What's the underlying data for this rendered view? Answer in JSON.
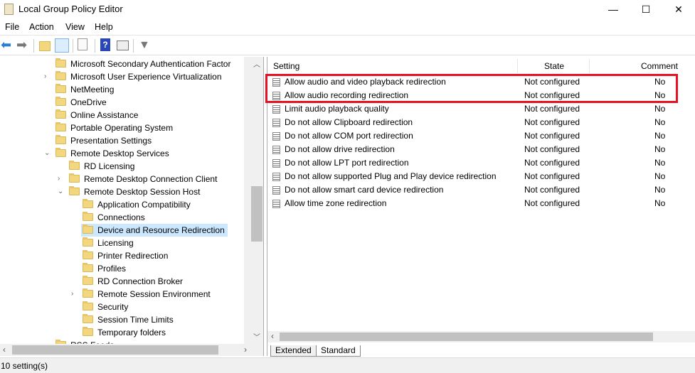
{
  "window": {
    "title": "Local Group Policy Editor",
    "minimize": "—",
    "maximize": "☐",
    "close": "✕"
  },
  "menu": [
    "File",
    "Action",
    "View",
    "Help"
  ],
  "toolbar": [
    "back-icon",
    "forward-icon",
    "up-folder-icon",
    "show-hide-tree-icon",
    "export-list-icon",
    "help-icon",
    "action-pane-icon",
    "filter-icon"
  ],
  "tree": [
    {
      "label": "Microsoft Secondary Authentication Factor",
      "level": 0,
      "expander": ""
    },
    {
      "label": "Microsoft User Experience Virtualization",
      "level": 0,
      "expander": "›"
    },
    {
      "label": "NetMeeting",
      "level": 0,
      "expander": ""
    },
    {
      "label": "OneDrive",
      "level": 0,
      "expander": ""
    },
    {
      "label": "Online Assistance",
      "level": 0,
      "expander": ""
    },
    {
      "label": "Portable Operating System",
      "level": 0,
      "expander": ""
    },
    {
      "label": "Presentation Settings",
      "level": 0,
      "expander": ""
    },
    {
      "label": "Remote Desktop Services",
      "level": 0,
      "expander": "⌄"
    },
    {
      "label": "RD Licensing",
      "level": 1,
      "expander": ""
    },
    {
      "label": "Remote Desktop Connection Client",
      "level": 1,
      "expander": "›"
    },
    {
      "label": "Remote Desktop Session Host",
      "level": 1,
      "expander": "⌄"
    },
    {
      "label": "Application Compatibility",
      "level": 2,
      "expander": ""
    },
    {
      "label": "Connections",
      "level": 2,
      "expander": ""
    },
    {
      "label": "Device and Resource Redirection",
      "level": 2,
      "expander": "",
      "selected": true
    },
    {
      "label": "Licensing",
      "level": 2,
      "expander": ""
    },
    {
      "label": "Printer Redirection",
      "level": 2,
      "expander": ""
    },
    {
      "label": "Profiles",
      "level": 2,
      "expander": ""
    },
    {
      "label": "RD Connection Broker",
      "level": 2,
      "expander": ""
    },
    {
      "label": "Remote Session Environment",
      "level": 2,
      "expander": "›"
    },
    {
      "label": "Security",
      "level": 2,
      "expander": ""
    },
    {
      "label": "Session Time Limits",
      "level": 2,
      "expander": ""
    },
    {
      "label": "Temporary folders",
      "level": 2,
      "expander": ""
    },
    {
      "label": "RSS Feeds",
      "level": 0,
      "expander": ""
    }
  ],
  "columns": {
    "setting": "Setting",
    "state": "State",
    "comment": "Comment"
  },
  "settings": [
    {
      "name": "Allow audio and video playback redirection",
      "state": "Not configured",
      "comment": "No"
    },
    {
      "name": "Allow audio recording redirection",
      "state": "Not configured",
      "comment": "No"
    },
    {
      "name": "Limit audio playback quality",
      "state": "Not configured",
      "comment": "No"
    },
    {
      "name": "Do not allow Clipboard redirection",
      "state": "Not configured",
      "comment": "No"
    },
    {
      "name": "Do not allow COM port redirection",
      "state": "Not configured",
      "comment": "No"
    },
    {
      "name": "Do not allow drive redirection",
      "state": "Not configured",
      "comment": "No"
    },
    {
      "name": "Do not allow LPT port redirection",
      "state": "Not configured",
      "comment": "No"
    },
    {
      "name": "Do not allow supported Plug and Play device redirection",
      "state": "Not configured",
      "comment": "No"
    },
    {
      "name": "Do not allow smart card device redirection",
      "state": "Not configured",
      "comment": "No"
    },
    {
      "name": "Allow time zone redirection",
      "state": "Not configured",
      "comment": "No"
    }
  ],
  "highlight_color": "#e81123",
  "tabs": [
    "Extended",
    "Standard"
  ],
  "status": "10 setting(s)"
}
